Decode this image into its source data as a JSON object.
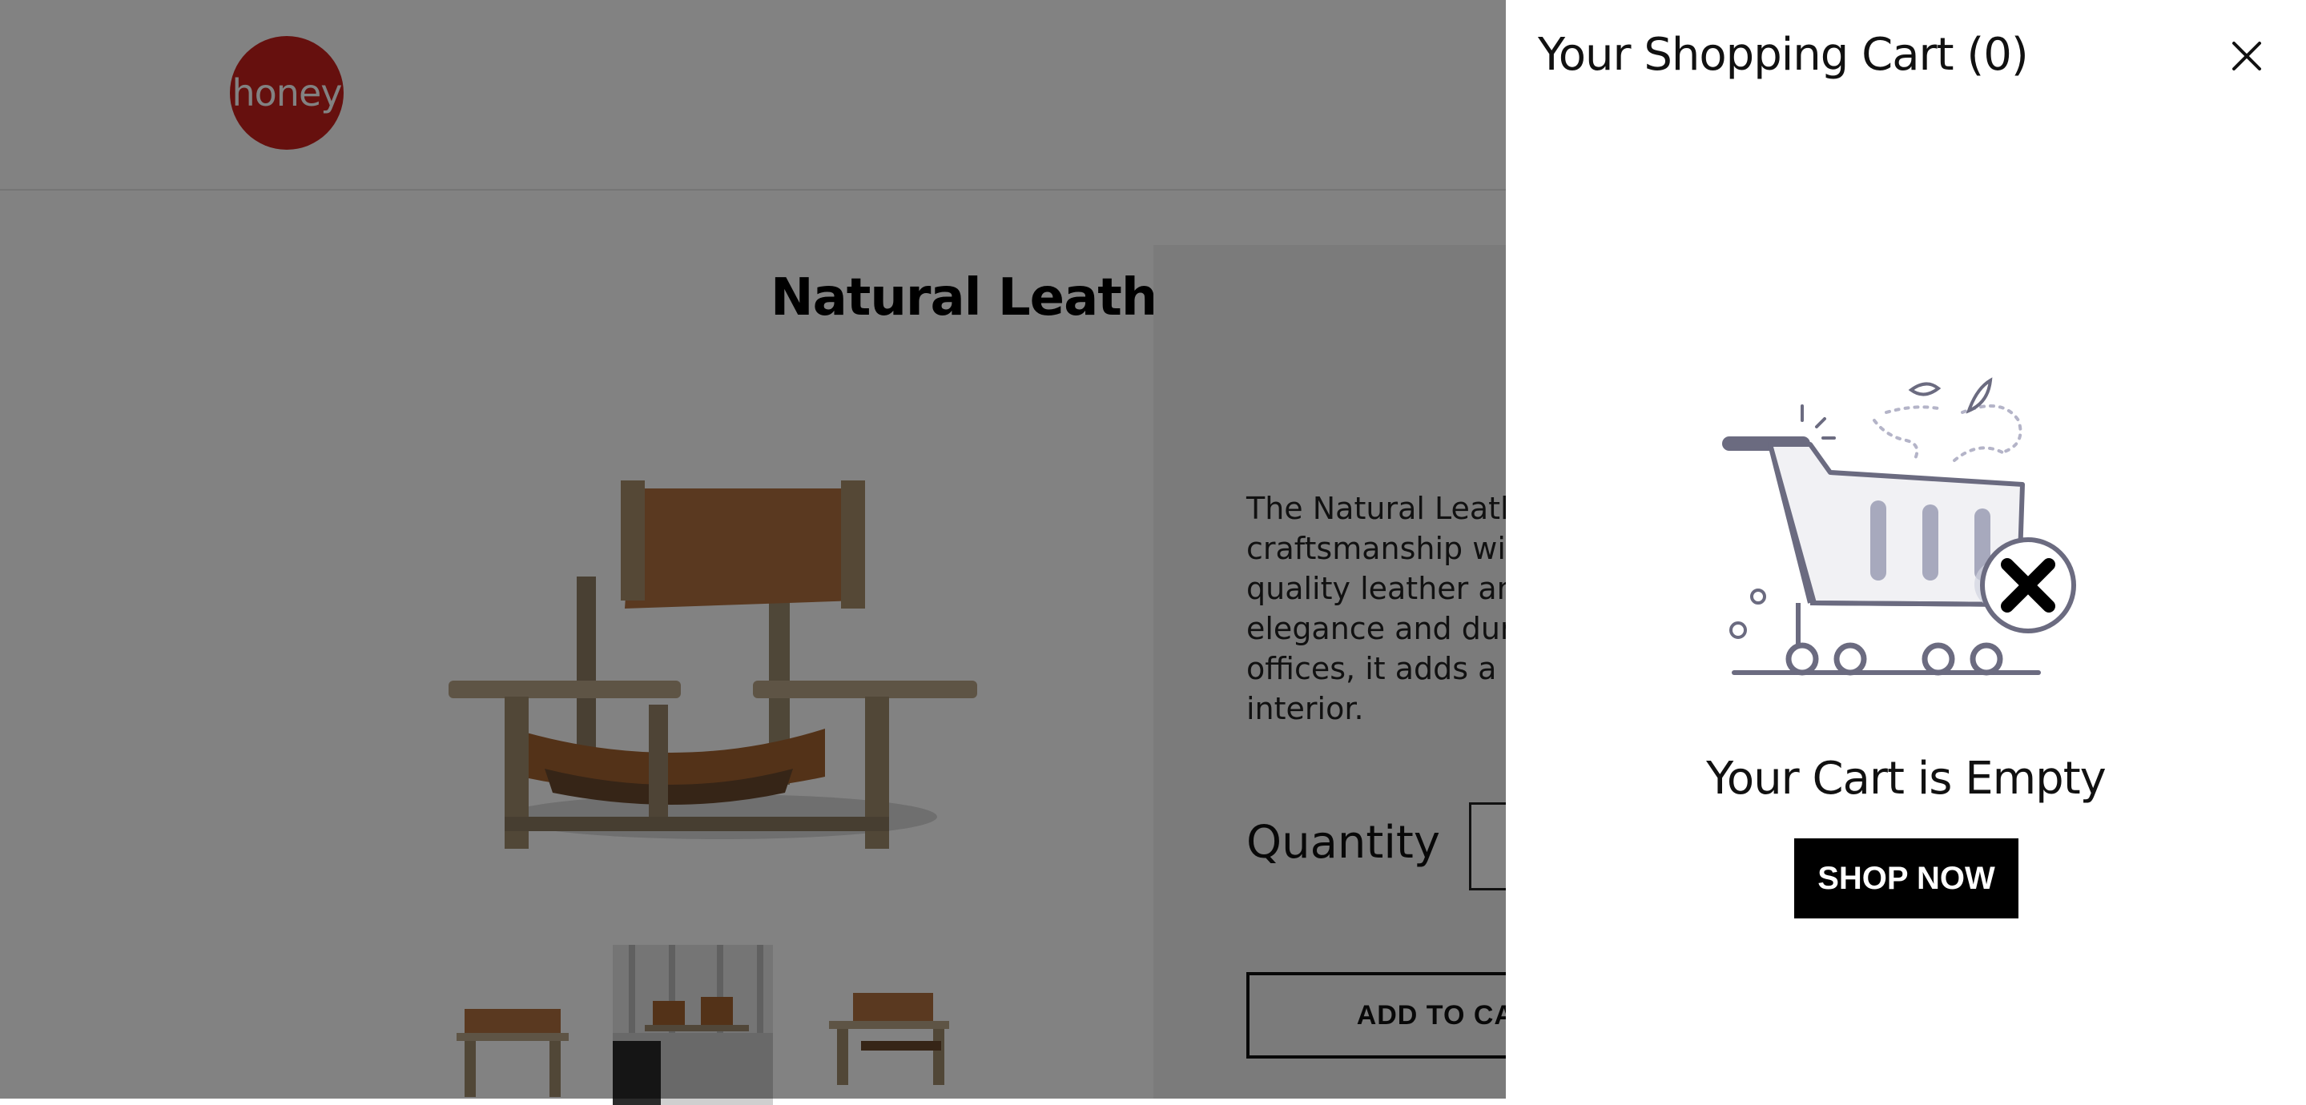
{
  "brand": {
    "logo_text": "honey",
    "logo_color": "#c8201c"
  },
  "product": {
    "title": "Natural Leather Spanish Chai",
    "description_lines": [
      "The Natural Leather",
      "craftsmanship with",
      "quality leather and a",
      "elegance and durab",
      "offices, it adds a tou",
      "interior."
    ],
    "quantity_label": "Quantity",
    "add_to_cart_label": "ADD TO CART"
  },
  "cart": {
    "title": "Your Shopping Cart (0)",
    "close_icon": "close-icon",
    "illustration_icon": "empty-cart-icon",
    "empty_message": "Your Cart is Empty",
    "shop_now_label": "SHOP NOW",
    "accent_color": "#6b6b80"
  }
}
